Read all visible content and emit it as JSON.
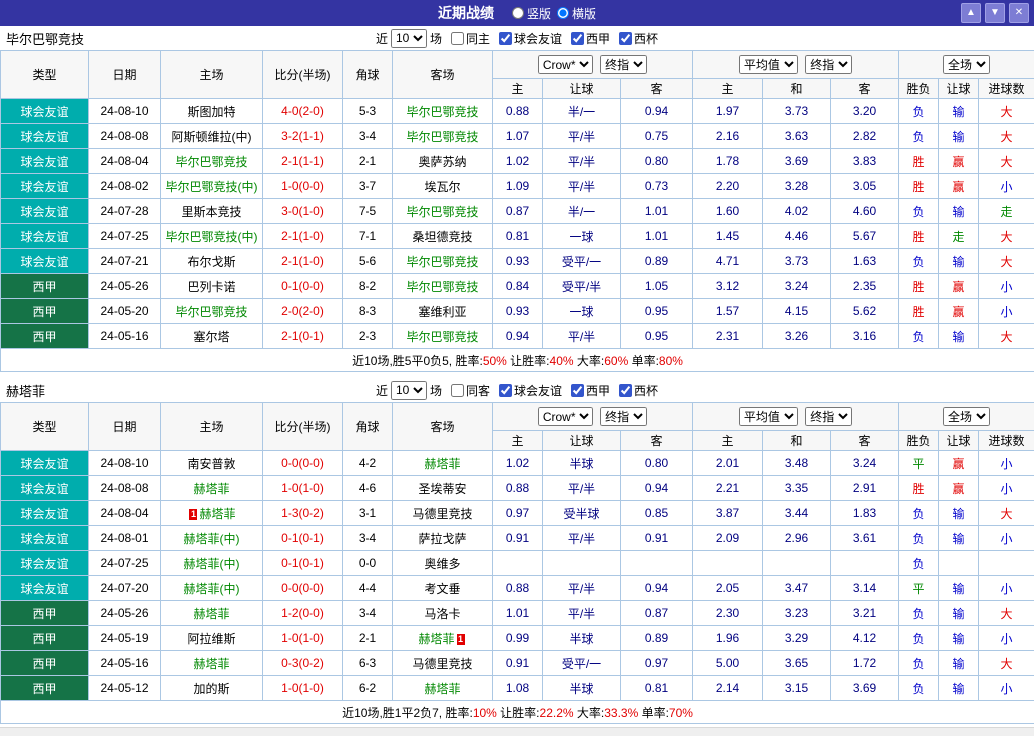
{
  "topbar": {
    "title": "近期战绩",
    "layout_vertical": "竖版",
    "layout_horizontal": "横版",
    "vertical_checked": false,
    "horizontal_checked": true,
    "up_symbol": "▲",
    "down_symbol": "▼",
    "close_symbol": "✕"
  },
  "ui": {
    "near": "近",
    "games": "场",
    "card": "1"
  },
  "headers": {
    "type": "类型",
    "date": "日期",
    "home": "主场",
    "score": "比分(半场)",
    "corner": "角球",
    "away": "客场",
    "host": "主",
    "handicap": "让球",
    "guest": "客",
    "draw": "和",
    "result": "胜负",
    "goals": "进球数"
  },
  "selects": {
    "source": "Crow*",
    "final": "终指",
    "avg": "平均值",
    "scope": "全场"
  },
  "colors": {
    "red": "#e10000",
    "highlight_team": "#008800",
    "odds_text": "#000080",
    "league": {
      "球会友谊": "#00adad",
      "西甲": "#157347"
    },
    "result": {
      "胜": "#e10000",
      "赢": "#e10000",
      "大": "#e10000",
      "负": "#0000cc",
      "输": "#0000cc",
      "小": "#0000cc",
      "平": "#008800",
      "走": "#008800"
    }
  },
  "tables": [
    {
      "team": "毕尔巴鄂竞技",
      "filter": {
        "games": "10",
        "same_label": "同主",
        "same_checked": false,
        "leagues": [
          {
            "label": "球会友谊",
            "checked": true
          },
          {
            "label": "西甲",
            "checked": true
          },
          {
            "label": "西杯",
            "checked": true
          }
        ]
      },
      "rows": [
        {
          "league": "球会友谊",
          "date": "24-08-10",
          "home": "斯图加特",
          "score": "4-0(2-0)",
          "corner": "5-3",
          "away": "毕尔巴鄂竞技",
          "awayHL": true,
          "o1": "0.88",
          "o2": "半/一",
          "o3": "0.94",
          "a1": "1.97",
          "a2": "3.73",
          "a3": "3.20",
          "r1": "负",
          "r2": "输",
          "r3": "大"
        },
        {
          "league": "球会友谊",
          "date": "24-08-08",
          "home": "阿斯顿维拉(中)",
          "score": "3-2(1-1)",
          "corner": "3-4",
          "away": "毕尔巴鄂竞技",
          "awayHL": true,
          "o1": "1.07",
          "o2": "平/半",
          "o3": "0.75",
          "a1": "2.16",
          "a2": "3.63",
          "a3": "2.82",
          "r1": "负",
          "r2": "输",
          "r3": "大"
        },
        {
          "league": "球会友谊",
          "date": "24-08-04",
          "home": "毕尔巴鄂竞技",
          "homeHL": true,
          "score": "2-1(1-1)",
          "corner": "2-1",
          "away": "奥萨苏纳",
          "o1": "1.02",
          "o2": "平/半",
          "o3": "0.80",
          "a1": "1.78",
          "a2": "3.69",
          "a3": "3.83",
          "r1": "胜",
          "r2": "赢",
          "r3": "大"
        },
        {
          "league": "球会友谊",
          "date": "24-08-02",
          "home": "毕尔巴鄂竞技(中)",
          "homeHL": true,
          "score": "1-0(0-0)",
          "corner": "3-7",
          "away": "埃瓦尔",
          "o1": "1.09",
          "o2": "平/半",
          "o3": "0.73",
          "a1": "2.20",
          "a2": "3.28",
          "a3": "3.05",
          "r1": "胜",
          "r2": "赢",
          "r3": "小"
        },
        {
          "league": "球会友谊",
          "date": "24-07-28",
          "home": "里斯本竞技",
          "score": "3-0(1-0)",
          "corner": "7-5",
          "away": "毕尔巴鄂竞技",
          "awayHL": true,
          "o1": "0.87",
          "o2": "半/一",
          "o3": "1.01",
          "a1": "1.60",
          "a2": "4.02",
          "a3": "4.60",
          "r1": "负",
          "r2": "输",
          "r3": "走"
        },
        {
          "league": "球会友谊",
          "date": "24-07-25",
          "home": "毕尔巴鄂竞技(中)",
          "homeHL": true,
          "score": "2-1(1-0)",
          "corner": "7-1",
          "away": "桑坦德竞技",
          "o1": "0.81",
          "o2": "一球",
          "o3": "1.01",
          "a1": "1.45",
          "a2": "4.46",
          "a3": "5.67",
          "r1": "胜",
          "r2": "走",
          "r3": "大"
        },
        {
          "league": "球会友谊",
          "date": "24-07-21",
          "home": "布尔戈斯",
          "score": "2-1(1-0)",
          "corner": "5-6",
          "away": "毕尔巴鄂竞技",
          "awayHL": true,
          "o1": "0.93",
          "o2": "受平/一",
          "o3": "0.89",
          "a1": "4.71",
          "a2": "3.73",
          "a3": "1.63",
          "r1": "负",
          "r2": "输",
          "r3": "大"
        },
        {
          "league": "西甲",
          "date": "24-05-26",
          "home": "巴列卡诺",
          "score": "0-1(0-0)",
          "corner": "8-2",
          "away": "毕尔巴鄂竞技",
          "awayHL": true,
          "o1": "0.84",
          "o2": "受平/半",
          "o3": "1.05",
          "a1": "3.12",
          "a2": "3.24",
          "a3": "2.35",
          "r1": "胜",
          "r2": "赢",
          "r3": "小"
        },
        {
          "league": "西甲",
          "date": "24-05-20",
          "home": "毕尔巴鄂竞技",
          "homeHL": true,
          "score": "2-0(2-0)",
          "corner": "8-3",
          "away": "塞维利亚",
          "o1": "0.93",
          "o2": "一球",
          "o3": "0.95",
          "a1": "1.57",
          "a2": "4.15",
          "a3": "5.62",
          "r1": "胜",
          "r2": "赢",
          "r3": "小"
        },
        {
          "league": "西甲",
          "date": "24-05-16",
          "home": "塞尔塔",
          "score": "2-1(0-1)",
          "corner": "2-3",
          "away": "毕尔巴鄂竞技",
          "awayHL": true,
          "o1": "0.94",
          "o2": "平/半",
          "o3": "0.95",
          "a1": "2.31",
          "a2": "3.26",
          "a3": "3.16",
          "r1": "负",
          "r2": "输",
          "r3": "大"
        }
      ],
      "summary": [
        {
          "text": "近10场,胜5平0负5, 胜率:",
          "red": false
        },
        {
          "text": "50%",
          "red": true
        },
        {
          "text": " 让胜率:",
          "red": false
        },
        {
          "text": "40%",
          "red": true
        },
        {
          "text": " 大率:",
          "red": false
        },
        {
          "text": "60%",
          "red": true
        },
        {
          "text": " 单率:",
          "red": false
        },
        {
          "text": "80%",
          "red": true
        }
      ]
    },
    {
      "team": "赫塔菲",
      "filter": {
        "games": "10",
        "same_label": "同客",
        "same_checked": false,
        "leagues": [
          {
            "label": "球会友谊",
            "checked": true
          },
          {
            "label": "西甲",
            "checked": true
          },
          {
            "label": "西杯",
            "checked": true
          }
        ]
      },
      "rows": [
        {
          "league": "球会友谊",
          "date": "24-08-10",
          "home": "南安普敦",
          "score": "0-0(0-0)",
          "corner": "4-2",
          "away": "赫塔菲",
          "awayHL": true,
          "o1": "1.02",
          "o2": "半球",
          "o3": "0.80",
          "a1": "2.01",
          "a2": "3.48",
          "a3": "3.24",
          "r1": "平",
          "r2": "赢",
          "r3": "小"
        },
        {
          "league": "球会友谊",
          "date": "24-08-08",
          "home": "赫塔菲",
          "homeHL": true,
          "score": "1-0(1-0)",
          "corner": "4-6",
          "away": "圣埃蒂安",
          "o1": "0.88",
          "o2": "平/半",
          "o3": "0.94",
          "a1": "2.21",
          "a2": "3.35",
          "a3": "2.91",
          "r1": "胜",
          "r2": "赢",
          "r3": "小"
        },
        {
          "league": "球会友谊",
          "date": "24-08-04",
          "home": "赫塔菲",
          "homeHL": true,
          "homeCard": "before",
          "score": "1-3(0-2)",
          "corner": "3-1",
          "away": "马德里竞技",
          "o1": "0.97",
          "o2": "受半球",
          "o3": "0.85",
          "a1": "3.87",
          "a2": "3.44",
          "a3": "1.83",
          "r1": "负",
          "r2": "输",
          "r3": "大"
        },
        {
          "league": "球会友谊",
          "date": "24-08-01",
          "home": "赫塔菲(中)",
          "homeHL": true,
          "score": "0-1(0-1)",
          "corner": "3-4",
          "away": "萨拉戈萨",
          "o1": "0.91",
          "o2": "平/半",
          "o3": "0.91",
          "a1": "2.09",
          "a2": "2.96",
          "a3": "3.61",
          "r1": "负",
          "r2": "输",
          "r3": "小"
        },
        {
          "league": "球会友谊",
          "date": "24-07-25",
          "home": "赫塔菲(中)",
          "homeHL": true,
          "score": "0-1(0-1)",
          "corner": "0-0",
          "away": "奥维多",
          "o1": "",
          "o2": "",
          "o3": "",
          "a1": "",
          "a2": "",
          "a3": "",
          "r1": "负",
          "r2": "",
          "r3": ""
        },
        {
          "league": "球会友谊",
          "date": "24-07-20",
          "home": "赫塔菲(中)",
          "homeHL": true,
          "score": "0-0(0-0)",
          "corner": "4-4",
          "away": "考文垂",
          "o1": "0.88",
          "o2": "平/半",
          "o3": "0.94",
          "a1": "2.05",
          "a2": "3.47",
          "a3": "3.14",
          "r1": "平",
          "r2": "输",
          "r3": "小"
        },
        {
          "league": "西甲",
          "date": "24-05-26",
          "home": "赫塔菲",
          "homeHL": true,
          "score": "1-2(0-0)",
          "corner": "3-4",
          "away": "马洛卡",
          "o1": "1.01",
          "o2": "平/半",
          "o3": "0.87",
          "a1": "2.30",
          "a2": "3.23",
          "a3": "3.21",
          "r1": "负",
          "r2": "输",
          "r3": "大"
        },
        {
          "league": "西甲",
          "date": "24-05-19",
          "home": "阿拉维斯",
          "score": "1-0(1-0)",
          "corner": "2-1",
          "away": "赫塔菲",
          "awayHL": true,
          "awayCard": "after",
          "o1": "0.99",
          "o2": "半球",
          "o3": "0.89",
          "a1": "1.96",
          "a2": "3.29",
          "a3": "4.12",
          "r1": "负",
          "r2": "输",
          "r3": "小"
        },
        {
          "league": "西甲",
          "date": "24-05-16",
          "home": "赫塔菲",
          "homeHL": true,
          "score": "0-3(0-2)",
          "corner": "6-3",
          "away": "马德里竞技",
          "o1": "0.91",
          "o2": "受平/一",
          "o3": "0.97",
          "a1": "5.00",
          "a2": "3.65",
          "a3": "1.72",
          "r1": "负",
          "r2": "输",
          "r3": "大"
        },
        {
          "league": "西甲",
          "date": "24-05-12",
          "home": "加的斯",
          "score": "1-0(1-0)",
          "corner": "6-2",
          "away": "赫塔菲",
          "awayHL": true,
          "o1": "1.08",
          "o2": "半球",
          "o3": "0.81",
          "a1": "2.14",
          "a2": "3.15",
          "a3": "3.69",
          "r1": "负",
          "r2": "输",
          "r3": "小"
        }
      ],
      "summary": [
        {
          "text": "近10场,胜1平2负7, 胜率:",
          "red": false
        },
        {
          "text": "10%",
          "red": true
        },
        {
          "text": " 让胜率:",
          "red": false
        },
        {
          "text": "22.2%",
          "red": true
        },
        {
          "text": " 大率:",
          "red": false
        },
        {
          "text": "33.3%",
          "red": true
        },
        {
          "text": " 单率:",
          "red": false
        },
        {
          "text": "70%",
          "red": true
        }
      ]
    }
  ]
}
